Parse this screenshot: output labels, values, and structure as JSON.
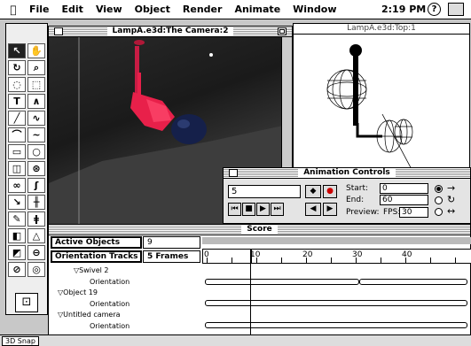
{
  "menubar": {
    "items": [
      "File",
      "Edit",
      "View",
      "Object",
      "Render",
      "Animate",
      "Window"
    ],
    "clock": "2:19 PM",
    "help": "?"
  },
  "camera_window": {
    "title": "LampA.e3d:The Camera:2"
  },
  "side_window": {
    "title": "LampA.e3d:Top:1"
  },
  "animation_controls": {
    "title": "Animation Controls",
    "frame_value": "5",
    "start_label": "Start:",
    "start_value": "0",
    "end_label": "End:",
    "end_value": "60",
    "preview_label": "Preview:",
    "fps_label": "FPS:",
    "fps_value": "30"
  },
  "score_window": {
    "title": "Score",
    "active_objects_label": "Active Objects",
    "active_objects_value": "9",
    "orientation_tracks_label": "Orientation Tracks",
    "frames_value": "5 Frames",
    "ruler_ticks": [
      "0",
      "10",
      "20",
      "30",
      "40"
    ],
    "tree": [
      {
        "label": "▽Swivel 2",
        "indent": 1
      },
      {
        "label": "Orientation",
        "indent": 2
      },
      {
        "label": "▽Object 19",
        "indent": 0
      },
      {
        "label": "Orientation",
        "indent": 2
      },
      {
        "label": "▽Untitled camera",
        "indent": 0
      },
      {
        "label": "Orientation",
        "indent": 2
      }
    ]
  },
  "status": {
    "zoom": "3D Snap"
  },
  "colors": {
    "lamp": "#e8204a",
    "sphere": "#1a2a5c",
    "background": "#c8c8c8"
  }
}
